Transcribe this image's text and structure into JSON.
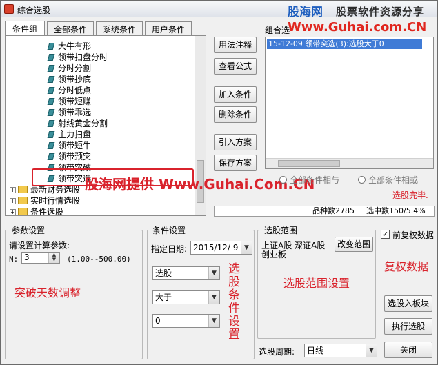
{
  "window": {
    "title": "综合选股"
  },
  "watermark": {
    "brand": "股海网",
    "tagline": "股票软件资源分享",
    "url": "Www.Guhai.com.CN",
    "overlay": "股海网提供 Www.Guhai.Com.CN"
  },
  "tabs": [
    {
      "label": "条件组"
    },
    {
      "label": "全部条件"
    },
    {
      "label": "系统条件"
    },
    {
      "label": "用户条件"
    }
  ],
  "tree": {
    "leaves": [
      "大牛有形",
      "领带扫盘分时",
      "分时分割",
      "领带抄底",
      "分时低点",
      "领带短赚",
      "领带乖选",
      "射线黄金分割",
      "主力扫盘",
      "领带短牛",
      "领带颈突",
      "领带突破",
      "领带突选"
    ],
    "folders": [
      "最新财务选股",
      "实时行情选股",
      "条件选股"
    ]
  },
  "buttons": {
    "usage": "用法注释",
    "formula": "查看公式",
    "add": "加入条件",
    "delete": "删除条件",
    "import": "引入方案",
    "save": "保存方案",
    "change_range": "改变范围",
    "to_block": "选股入板块",
    "execute": "执行选股",
    "close": "关闭"
  },
  "combo": {
    "label": "组合选",
    "selected_item": "15-12-09 领带突选(3):选股大于0"
  },
  "radios": {
    "and": "全部条件相与",
    "or": "全部条件相或"
  },
  "status": {
    "done": "选股完毕.",
    "count_label": "品种数",
    "count": "2785",
    "selected_label": "选中数",
    "selected": "150/5.4%"
  },
  "params": {
    "group": "参数设置",
    "prompt": "请设置计算参数:",
    "n_label": "N:",
    "n_value": "3",
    "range": "(1.00--500.00)",
    "annotation": "突破天数调整"
  },
  "conditions": {
    "group": "条件设置",
    "date_label": "指定日期:",
    "date_value": "2015/12/ 9",
    "mode": "选股",
    "operator": "大于",
    "value": "0",
    "annotation": "选股条件设置"
  },
  "scope": {
    "group": "选股范围",
    "line1": "上证A股  深证A股",
    "line2": "创业板",
    "annotation": "选股范围设置"
  },
  "adjust": {
    "checkbox_label": "前复权数据",
    "annotation": "复权数据"
  },
  "period": {
    "label": "选股周期:",
    "value": "日线"
  }
}
